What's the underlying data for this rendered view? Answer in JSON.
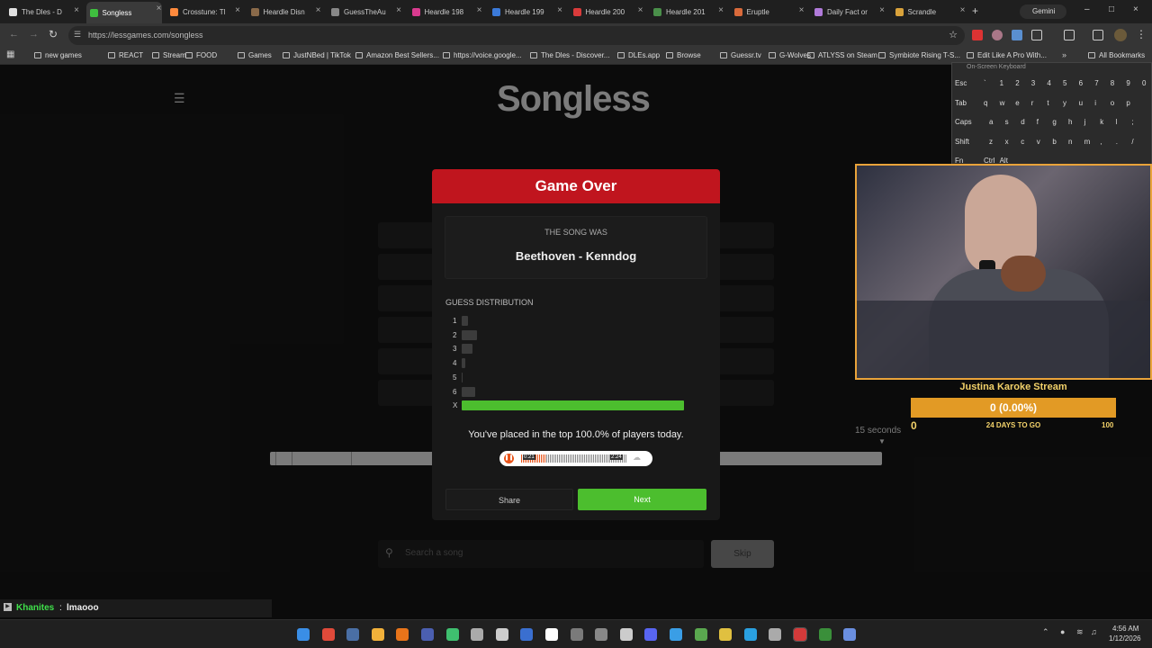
{
  "browser": {
    "tabs": [
      {
        "label": "The Dles - D",
        "color": "#e0e0e0"
      },
      {
        "label": "Songless",
        "color": "#3fbf3f"
      },
      {
        "label": "Crosstune: Tl",
        "color": "#ff8a3d"
      },
      {
        "label": "Heardle Disn",
        "color": "#8a6a4a"
      },
      {
        "label": "GuessTheAu",
        "color": "#888888"
      },
      {
        "label": "Heardle 198",
        "color": "#d93b8f"
      },
      {
        "label": "Heardle 199",
        "color": "#3b7ad9"
      },
      {
        "label": "Heardle 200",
        "color": "#d93b3b"
      },
      {
        "label": "Heardle 201",
        "color": "#4a8f4a"
      },
      {
        "label": "Eruptle",
        "color": "#d96a3b"
      },
      {
        "label": "Daily Fact or",
        "color": "#b07ad9"
      },
      {
        "label": "Scrandle",
        "color": "#d9a23b"
      }
    ],
    "new_tab": "+",
    "gemini": "Gemini",
    "url": "https://lessgames.com/songless",
    "bookmarks": [
      "new games",
      "REACT",
      "Stream",
      "FOOD",
      "Games",
      "JustNBed | TikTok",
      "Amazon Best Sellers...",
      "https://voice.google...",
      "The Dles - Discover...",
      "DLEs.app",
      "Browse",
      "Guessr.tv",
      "G-Wolves",
      "ATLYSS on Steam",
      "Symbiote Rising T-S...",
      "Edit Like A Pro With...",
      "All Bookmarks"
    ],
    "bookmarks_more": "»"
  },
  "page": {
    "logo": "Songless",
    "search_placeholder": "Search a song",
    "skip_label": "Skip",
    "timer_label": "15 seconds"
  },
  "modal": {
    "title": "Game Over",
    "song_caption": "THE SONG WAS",
    "song_title": "Beethoven - Kenndog",
    "distribution_heading": "GUESS DISTRIBUTION",
    "distribution": [
      {
        "label": "1",
        "value": 0.03
      },
      {
        "label": "2",
        "value": 0.07
      },
      {
        "label": "3",
        "value": 0.05
      },
      {
        "label": "4",
        "value": 0.015
      },
      {
        "label": "5",
        "value": 0.0
      },
      {
        "label": "6",
        "value": 0.06
      },
      {
        "label": "X",
        "value": 1.0
      }
    ],
    "placed_text": "You've placed in the top 100.0% of players today.",
    "player_time_left": "0:21",
    "player_time_right": "2:24",
    "share_label": "Share",
    "next_label": "Next",
    "accent_red": "#c0151e",
    "accent_green": "#4cbe2e"
  },
  "stream": {
    "goal_title": "Justina Karoke Stream",
    "goal_value": "0 (0.00%)",
    "goal_sub": "24 DAYS TO GO",
    "goal_min": "0",
    "goal_max": "100",
    "goal_progress": 0.0,
    "chat_user": "Khanites",
    "chat_sep": ":",
    "chat_msg": "lmaooo"
  },
  "keyboard": {
    "title": "On-Screen Keyboard",
    "rows": [
      [
        "Esc",
        "`",
        "1",
        "2",
        "3",
        "4",
        "5",
        "6",
        "7",
        "8",
        "9",
        "0"
      ],
      [
        "Tab",
        "q",
        "w",
        "e",
        "r",
        "t",
        "y",
        "u",
        "i",
        "o",
        "p"
      ],
      [
        "Caps",
        "a",
        "s",
        "d",
        "f",
        "g",
        "h",
        "j",
        "k",
        "l",
        ";"
      ],
      [
        "Shift",
        "z",
        "x",
        "c",
        "v",
        "b",
        "n",
        "m",
        ",",
        ".",
        "/"
      ],
      [
        "Fn",
        "Ctrl",
        "Alt"
      ]
    ]
  },
  "taskbar": {
    "time": "4:56 AM",
    "date": "1/12/2026"
  }
}
